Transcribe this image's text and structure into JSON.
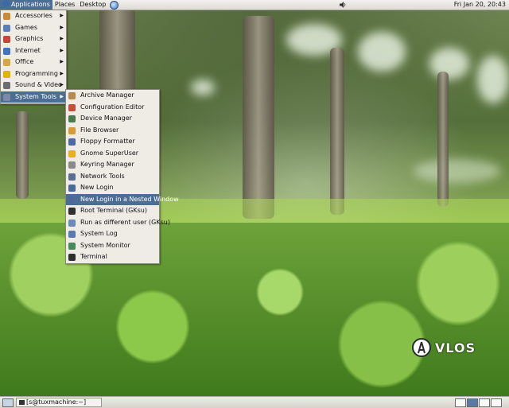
{
  "top_panel": {
    "menus": [
      "Applications",
      "Places",
      "Desktop"
    ],
    "clock": "Fri Jan 20, 20:43"
  },
  "applications_menu": {
    "items": [
      {
        "label": "Accessories",
        "icon": "accessories-icon",
        "color": "#c98a3a"
      },
      {
        "label": "Games",
        "icon": "games-icon",
        "color": "#5a7fc0"
      },
      {
        "label": "Graphics",
        "icon": "graphics-icon",
        "color": "#c04a3a"
      },
      {
        "label": "Internet",
        "icon": "internet-icon",
        "color": "#3f74c2"
      },
      {
        "label": "Office",
        "icon": "office-icon",
        "color": "#d6a93c"
      },
      {
        "label": "Programming",
        "icon": "programming-icon",
        "color": "#e0b400"
      },
      {
        "label": "Sound & Video",
        "icon": "sound-video-icon",
        "color": "#6e6e6e"
      },
      {
        "label": "System Tools",
        "icon": "system-tools-icon",
        "color": "#7c8aa8",
        "active": true
      }
    ]
  },
  "system_tools_menu": {
    "items": [
      {
        "label": "Archive Manager",
        "icon": "archive-manager-icon",
        "color": "#b58a4a"
      },
      {
        "label": "Configuration Editor",
        "icon": "configuration-editor-icon",
        "color": "#c0503a"
      },
      {
        "label": "Device Manager",
        "icon": "device-manager-icon",
        "color": "#4a7a4a"
      },
      {
        "label": "File Browser",
        "icon": "file-browser-icon",
        "color": "#d59a3a"
      },
      {
        "label": "Floppy Formatter",
        "icon": "floppy-formatter-icon",
        "color": "#4a6aa0"
      },
      {
        "label": "Gnome SuperUser",
        "icon": "gnome-superuser-icon",
        "color": "#e8b020"
      },
      {
        "label": "Keyring Manager",
        "icon": "keyring-manager-icon",
        "color": "#8a8a8a"
      },
      {
        "label": "Network Tools",
        "icon": "network-tools-icon",
        "color": "#5a6f8f"
      },
      {
        "label": "New Login",
        "icon": "new-login-icon",
        "color": "#4a6a9a"
      },
      {
        "label": "New Login in a Nested Window",
        "icon": "nested-login-icon",
        "color": "#4a6a9a",
        "active": true
      },
      {
        "label": "Root Terminal (GKsu)",
        "icon": "root-terminal-icon",
        "color": "#2f2f2f"
      },
      {
        "label": "Run as different user (GKsu)",
        "icon": "run-as-user-icon",
        "color": "#6a8ab8"
      },
      {
        "label": "System Log",
        "icon": "system-log-icon",
        "color": "#5a7ab0"
      },
      {
        "label": "System Monitor",
        "icon": "system-monitor-icon",
        "color": "#4a8a5a"
      },
      {
        "label": "Terminal",
        "icon": "terminal-icon",
        "color": "#2f2f2f"
      }
    ]
  },
  "bottom_panel": {
    "task_label": "[s@tuxmachine:~]",
    "workspaces": 4,
    "active_workspace": 1
  },
  "logo": {
    "text": "VLOS"
  },
  "colors": {
    "highlight": "#4d6e94",
    "menu_bg": "#efece6"
  }
}
